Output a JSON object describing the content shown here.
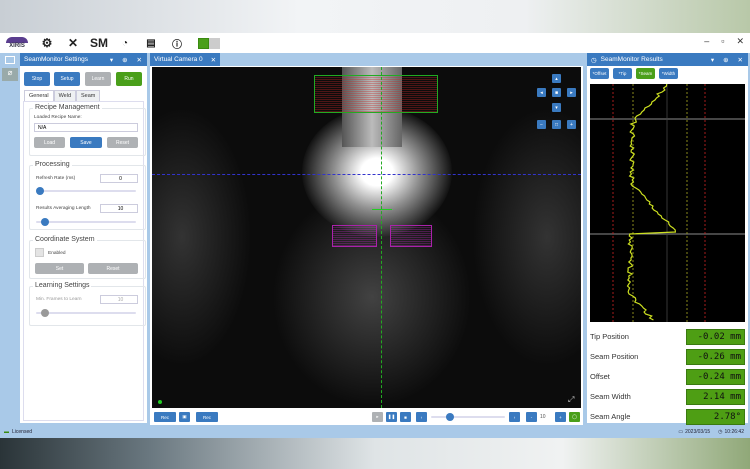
{
  "toolbar": {
    "logo": "XIRIS",
    "sm": "SM",
    "icons": [
      "gear-icon",
      "tools-icon",
      "sm-icon",
      "gauge-icon",
      "document-icon",
      "help-icon",
      "view-toggle-icon"
    ],
    "window": [
      "–",
      "▫",
      "✕"
    ]
  },
  "settings": {
    "title": "SeamMonitor Settings",
    "header_controls": [
      "▾",
      "⊕",
      "✕"
    ],
    "buttons": {
      "stop": "Stop",
      "setup": "Setup",
      "learn": "Learn",
      "run": "Run"
    },
    "tabs": [
      "General",
      "Weld",
      "Seam"
    ],
    "recipe": {
      "title": "Recipe Management",
      "label": "Loaded Recipe Name:",
      "value": "N/A",
      "load": "Load",
      "save": "Save",
      "reset": "Reset"
    },
    "processing": {
      "title": "Processing",
      "refresh_label": "Refresh Rate (ms)",
      "refresh_value": "0",
      "refresh_slider": 0.0,
      "avg_label": "Results Averaging Length",
      "avg_value": "10",
      "avg_slider": 0.05
    },
    "coord": {
      "title": "Coordinate System",
      "enabled": "Enabled",
      "set": "Set",
      "reset": "Reset"
    },
    "learning": {
      "title": "Learning Settings",
      "frames_label": "Min. Frames to Learn",
      "frames_value": "10",
      "frames_slider": 0.05
    }
  },
  "camera": {
    "tab": "Virtual Camera 0",
    "close": "✕",
    "rec1": "Rec",
    "rec2": "Rec",
    "frame_value": "10",
    "playback_slider": 0.2
  },
  "results": {
    "title": "SeamMonitor Results",
    "buttons": [
      {
        "label": "*Offset",
        "active": false
      },
      {
        "label": "*Tip",
        "active": false
      },
      {
        "label": "*Seam",
        "active": true
      },
      {
        "label": "*Width",
        "active": false
      }
    ],
    "rows": [
      {
        "name": "Tip Position",
        "value": "-0.02 mm"
      },
      {
        "name": "Seam Position",
        "value": "-0.26 mm"
      },
      {
        "name": "Offset",
        "value": "-0.24 mm"
      },
      {
        "name": "Seam Width",
        "value": "2.14 mm"
      },
      {
        "name": "Seam Angle",
        "value": "2.78°"
      }
    ]
  },
  "status": {
    "license": "Licensed",
    "date": "2023/03/15",
    "time": "10:26:42"
  },
  "colors": {
    "accent": "#3a7ac0",
    "run": "#4a9f1a",
    "value_bg": "#4e9e14"
  }
}
